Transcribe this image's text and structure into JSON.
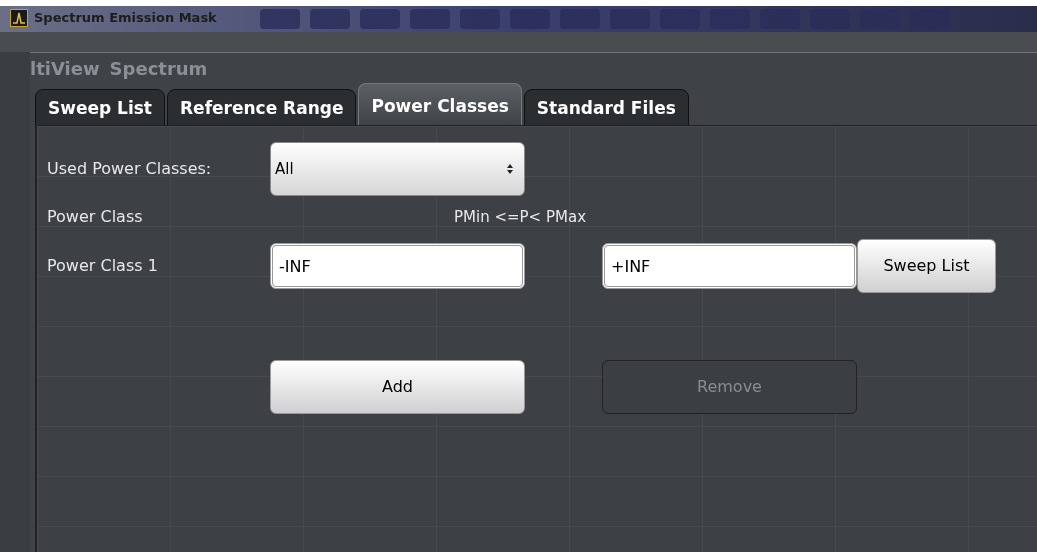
{
  "window": {
    "title": "Spectrum Emission Mask"
  },
  "background_tabs": [
    "ltiView",
    "Spectrum"
  ],
  "tabs": [
    {
      "label": "Sweep List",
      "selected": false
    },
    {
      "label": "Reference Range",
      "selected": false
    },
    {
      "label": "Power Classes",
      "selected": true
    },
    {
      "label": "Standard Files",
      "selected": false
    }
  ],
  "used_power_classes": {
    "label": "Used Power Classes:",
    "value": "All"
  },
  "header": {
    "label": "Power Class",
    "range": "PMin <=P< PMax"
  },
  "power_classes": [
    {
      "label": "Power Class 1",
      "pmin": "-INF",
      "pmax": "+INF",
      "button": "Sweep List"
    }
  ],
  "buttons": [
    {
      "label": "Add",
      "disabled": false
    },
    {
      "label": "Remove",
      "disabled": true
    }
  ]
}
